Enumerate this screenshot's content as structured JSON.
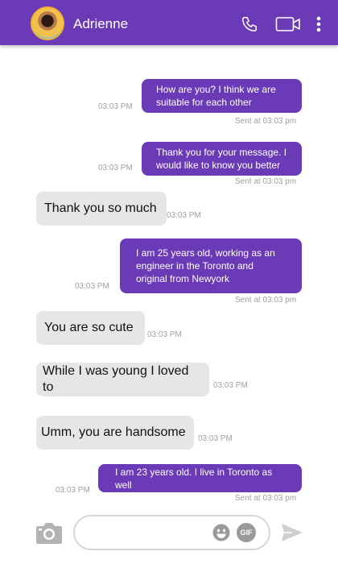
{
  "header": {
    "contact_name": "Adrienne",
    "icons": [
      "avatar",
      "phone-icon",
      "video-camera-icon",
      "more-vertical-icon"
    ]
  },
  "messages": [
    {
      "direction": "out",
      "text": "How are you? I think  we are suitable for each other",
      "time": "03:03 PM",
      "status": "Sent at 03:03 pm"
    },
    {
      "direction": "out",
      "text": "Thank you for your message. I would like to know you better",
      "time": "03:03 PM",
      "status": "Sent at 03:03 pm"
    },
    {
      "direction": "in",
      "text": "Thank you so much",
      "time": "03:03 PM"
    },
    {
      "direction": "out",
      "text": "I am 25 years old, working as an engineer in the Toronto and original from Newyork",
      "time": "03:03 PM",
      "status": "Sent at 03:03 pm"
    },
    {
      "direction": "in",
      "text": "You are so cute",
      "time": "03:03 PM"
    },
    {
      "direction": "in",
      "text": "While I was young I loved to",
      "time": "03:03 PM"
    },
    {
      "direction": "in",
      "text": "Umm, you are handsome",
      "time": "03:03 PM"
    },
    {
      "direction": "out",
      "text": "I am 23 years old. I live in Toronto as well",
      "time": "03:03 PM",
      "status": "Sent at 03:03 pm"
    }
  ],
  "composer": {
    "placeholder": "",
    "value": "",
    "gif_label": "GIF",
    "icons": [
      "camera-icon",
      "emoji-icon",
      "gif-icon",
      "send-icon"
    ]
  },
  "colors": {
    "accent": "#6a3ab7",
    "incoming_bubble": "#e6e6e6",
    "timestamp": "#a0a0a0"
  }
}
